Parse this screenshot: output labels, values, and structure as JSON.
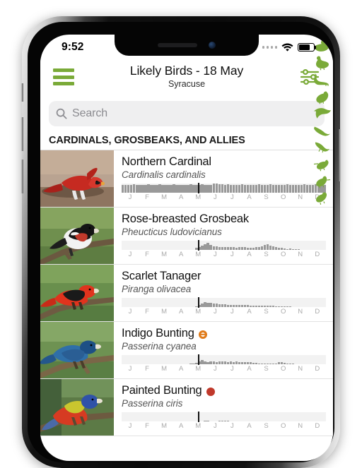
{
  "status_bar": {
    "time": "9:52",
    "signal_dots": 4,
    "wifi_icon": "wifi-icon",
    "battery_icon": "battery-icon",
    "battery_level": 78
  },
  "header": {
    "menu_icon": "hamburger-menu-icon",
    "title": "Likely Birds - 18 May",
    "subtitle": "Syracuse",
    "filter_icon": "sliders-filter-icon",
    "accent_color": "#7aaa38"
  },
  "search": {
    "icon": "search-icon",
    "placeholder": "Search",
    "value": ""
  },
  "section": {
    "title": "CARDINALS, GROSBEAKS, AND ALLIES"
  },
  "months": [
    "J",
    "F",
    "M",
    "A",
    "M",
    "J",
    "J",
    "A",
    "S",
    "O",
    "N",
    "D"
  ],
  "today_position_pct": 37.5,
  "badges": {
    "rare_color": "#c0392b",
    "uncommon_color": "#e07b1a"
  },
  "birds": [
    {
      "name": "Northern Cardinal",
      "scientific_name": "Cardinalis cardinalis",
      "badge": "",
      "thumb": "northern-cardinal-photo",
      "abundance": [
        62,
        60,
        63,
        61,
        64,
        62,
        60,
        63,
        62,
        64,
        63,
        61,
        62,
        64,
        62,
        60,
        63,
        61,
        64,
        62,
        63,
        61,
        60,
        62,
        64,
        63,
        61,
        62,
        64,
        62,
        60,
        63,
        70,
        72,
        68,
        66,
        62,
        64,
        62,
        60,
        63,
        61,
        64,
        62,
        63,
        61,
        60,
        62,
        64,
        63,
        61,
        62,
        64,
        62,
        60,
        63,
        61,
        62,
        64,
        62,
        63,
        61,
        60,
        62,
        64,
        63,
        61,
        62,
        64,
        62,
        60,
        63
      ]
    },
    {
      "name": "Rose-breasted Grosbeak",
      "scientific_name": "Pheucticus ludovicianus",
      "badge": "",
      "thumb": "rose-breasted-grosbeak-photo",
      "abundance": [
        0,
        0,
        0,
        0,
        0,
        0,
        0,
        0,
        0,
        0,
        0,
        0,
        0,
        0,
        0,
        0,
        0,
        0,
        0,
        0,
        0,
        0,
        0,
        0,
        0,
        0,
        14,
        22,
        34,
        46,
        58,
        40,
        30,
        26,
        24,
        22,
        20,
        24,
        22,
        20,
        18,
        20,
        22,
        20,
        18,
        16,
        18,
        20,
        22,
        30,
        38,
        42,
        34,
        28,
        22,
        18,
        14,
        10,
        8,
        12,
        8,
        6,
        4,
        0,
        0,
        0,
        0,
        0,
        0,
        0,
        0,
        0
      ]
    },
    {
      "name": "Scarlet Tanager",
      "scientific_name": "Piranga olivacea",
      "badge": "",
      "thumb": "scarlet-tanager-photo",
      "abundance": [
        0,
        0,
        0,
        0,
        0,
        0,
        0,
        0,
        0,
        0,
        0,
        0,
        0,
        0,
        0,
        0,
        0,
        0,
        0,
        0,
        0,
        0,
        0,
        0,
        0,
        0,
        8,
        18,
        28,
        40,
        36,
        32,
        28,
        26,
        24,
        22,
        20,
        18,
        18,
        16,
        16,
        16,
        14,
        14,
        14,
        12,
        12,
        12,
        12,
        12,
        12,
        10,
        10,
        10,
        8,
        8,
        6,
        8,
        6,
        4,
        0,
        0,
        0,
        0,
        0,
        0,
        0,
        0,
        0,
        0,
        0,
        0
      ]
    },
    {
      "name": "Indigo Bunting",
      "scientific_name": "Passerina cyanea",
      "badge": "uncommon",
      "thumb": "indigo-bunting-photo",
      "abundance": [
        0,
        0,
        0,
        0,
        0,
        0,
        0,
        0,
        0,
        0,
        0,
        0,
        0,
        0,
        0,
        0,
        0,
        0,
        0,
        0,
        0,
        0,
        0,
        0,
        6,
        8,
        10,
        22,
        34,
        20,
        18,
        22,
        20,
        18,
        20,
        22,
        20,
        18,
        20,
        18,
        20,
        18,
        16,
        18,
        16,
        14,
        12,
        10,
        8,
        6,
        8,
        6,
        4,
        4,
        6,
        14,
        16,
        10,
        6,
        4,
        4,
        0,
        0,
        0,
        0,
        0,
        0,
        0,
        0,
        0,
        0,
        0
      ]
    },
    {
      "name": "Painted Bunting",
      "scientific_name": "Passerina ciris",
      "badge": "rare",
      "thumb": "painted-bunting-photo",
      "abundance": [
        0,
        0,
        0,
        0,
        0,
        0,
        0,
        0,
        0,
        0,
        0,
        0,
        0,
        0,
        0,
        0,
        0,
        0,
        0,
        0,
        0,
        0,
        0,
        0,
        0,
        0,
        0,
        0,
        0,
        4,
        5,
        0,
        0,
        0,
        5,
        4,
        5,
        4,
        0,
        0,
        0,
        0,
        0,
        0,
        0,
        0,
        0,
        0,
        0,
        0,
        0,
        0,
        0,
        0,
        0,
        0,
        0,
        0,
        0,
        0,
        0,
        0,
        0,
        0,
        0,
        0,
        0,
        0,
        0,
        0,
        0,
        0
      ]
    }
  ],
  "scroll_index": {
    "color": "#7aaa38",
    "icons": [
      "duck-icon",
      "goose-icon",
      "heron-icon",
      "pigeon-icon",
      "raptor-icon",
      "swallow-icon",
      "hummingbird-icon",
      "crow-icon",
      "sparrow-icon",
      "finch-icon"
    ]
  }
}
